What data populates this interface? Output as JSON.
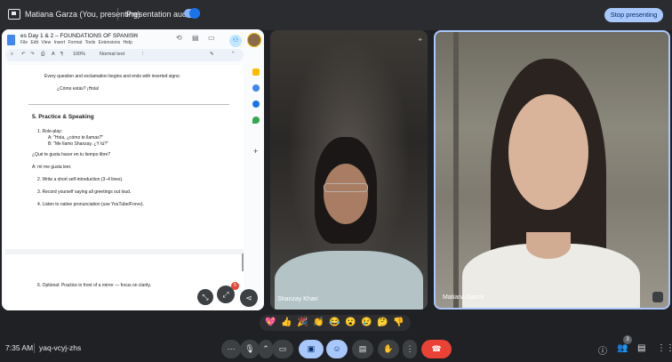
{
  "topbar": {
    "presenter_name": "Matiana Garza (You, presenting)",
    "audio_label": "Presentation audio",
    "stop_label": "Stop presenting"
  },
  "doc": {
    "title": "es Day 1 & 2 – FOUNDATIONS OF SPANISH",
    "menu": "File  Edit  View  Insert  Format  Tools  Extensions  Help",
    "zoom": "100%",
    "style": "Normal text",
    "lines": {
      "bullet1": "Every question and exclamation begins and ends with inverted signs:",
      "sub1": "¿Cómo estás? ¡Hola!",
      "heading": "5. Practice & Speaking",
      "item1": "1.   Role-play:",
      "item1a": "A: \"Hola, ¿cómo te llamas?\"",
      "item1b": "B: \"Me llamo Shanzay. ¿Y tú?\"",
      "q": "¿Qué te gusta hacer en tu tiempo libre?",
      "a": "A: mí me gusta leer.",
      "item2": "2.   Write a short self-introduction (3–4 lines).",
      "item3": "3.   Record yourself saying all greetings out loud.",
      "item4": "4.   Listen to native pronunciation (use YouTube/Forvo).",
      "item6": "6.   Optional: Practice in front of a mirror — focus on clarity."
    },
    "badge": "5"
  },
  "tiles": {
    "left_name": "Shanzay Khan",
    "right_name": "Matiana Garza"
  },
  "reactions": [
    "💖",
    "👍",
    "🎉",
    "👏",
    "😂",
    "😮",
    "😢",
    "🤔",
    "👎"
  ],
  "bottom": {
    "time": "7:35 AM",
    "code": "yaq-vcyj-zhs",
    "people_count": "3"
  },
  "colors": {
    "accent": "#a8c7fa",
    "leave": "#ea4335"
  }
}
